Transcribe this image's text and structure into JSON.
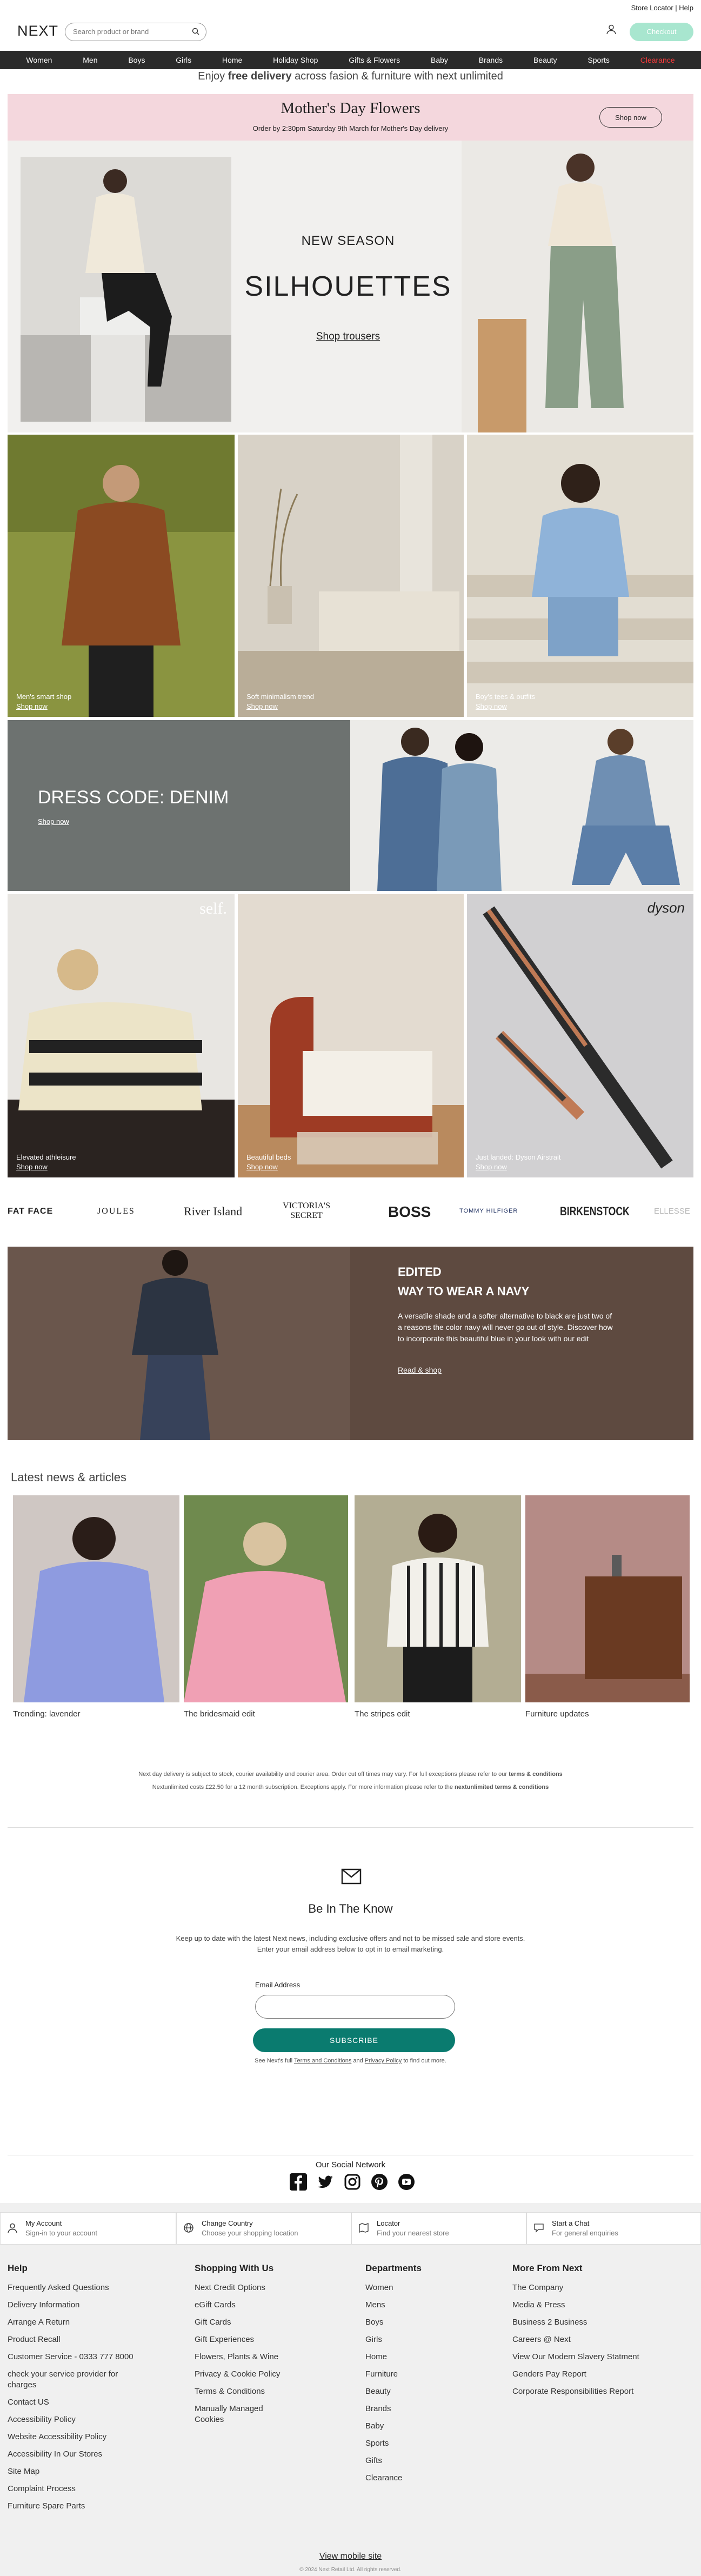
{
  "utility": {
    "links": "Store Locator | Help"
  },
  "header": {
    "logo": "NEXT",
    "search_placeholder": "Search product or brand",
    "checkout": "Checkout"
  },
  "nav": [
    "Women",
    "Men",
    "Boys",
    "Girls",
    "Home",
    "Holiday Shop",
    "Gifts & Flowers",
    "Baby",
    "Brands",
    "Beauty",
    "Sports",
    "Clearance"
  ],
  "promo": {
    "prefix": "Enjoy ",
    "bold": "free delivery",
    "suffix": " across fasion & furniture with next unlimited"
  },
  "mothers_day": {
    "title": "Mother's Day Flowers",
    "subtitle": "Order by 2:30pm Saturday 9th March for Mother's Day delivery",
    "button": "Shop now"
  },
  "hero": {
    "eyebrow": "NEW SEASON",
    "title": "SILHOUETTES",
    "link": "Shop trousers"
  },
  "tiles_row1": [
    {
      "caption": "Men's smart shop",
      "link": "Shop now"
    },
    {
      "caption": "Soft minimalism trend",
      "link": "Shop now"
    },
    {
      "caption": "Boy's tees & outfits",
      "link": "Shop now"
    }
  ],
  "denim": {
    "title": "DRESS CODE: DENIM",
    "link": "Shop now"
  },
  "tiles_row2": [
    {
      "caption": "Elevated athleisure",
      "link": "Shop now",
      "badge": "self."
    },
    {
      "caption": "Beautiful beds",
      "link": "Shop now"
    },
    {
      "caption": "Just landed: Dyson Airstrait",
      "link": "Shop now",
      "badge": "dyson"
    }
  ],
  "brands": [
    "FAT FACE",
    "JOULES",
    "River Island",
    "VICTORIA'S SECRET",
    "BOSS",
    "TOMMY HILFIGER",
    "BIRKENSTOCK",
    "ELLESSE"
  ],
  "edited": {
    "eyebrow": "EDITED",
    "title": "WAY TO WEAR A NAVY",
    "body": "A versatile shade and a softer alternative to black are just two of a reasons the color navy will never go out of style. Discover how to incorporate this beautiful blue in your look with our edit",
    "link": "Read & shop"
  },
  "news": {
    "title": "Latest news & articles",
    "items": [
      {
        "label": "Trending: lavender"
      },
      {
        "label": "The bridesmaid edit"
      },
      {
        "label": "The stripes edit"
      },
      {
        "label": "Furniture updates"
      }
    ]
  },
  "legal": {
    "line1": "Next day delivery is subject to stock, courier availability and courier area. Order cut off times may vary. For full exceptions please refer to our",
    "line1_link": "terms & conditions",
    "line2": "Nextunlimited costs £22.50 for a 12 month subscription. Exceptions apply. For more information please refer to the",
    "line2_link": "nextunlimited terms & conditions"
  },
  "newsletter": {
    "title": "Be In The Know",
    "body1": "Keep up to date with the latest Next news, including exclusive offers and not to be missed sale and store events.",
    "body2": "Enter your email address below to opt in to email marketing.",
    "field_label": "Email Address",
    "button": "SUBSCRIBE",
    "fine_prefix": "See Next's full",
    "terms": "Terms and Conditions",
    "and": "and",
    "privacy": "Privacy Policy",
    "fine_suffix": "to find out more."
  },
  "social": {
    "title": "Our Social Network"
  },
  "help_boxes": [
    {
      "title": "My Account",
      "sub": "Sign-in to your account"
    },
    {
      "title": "Change Country",
      "sub": "Choose your shopping location"
    },
    {
      "title": "Locator",
      "sub": "Find your nearest store"
    },
    {
      "title": "Start a Chat",
      "sub": "For general enquiries"
    }
  ],
  "footer": {
    "help": {
      "title": "Help",
      "items": [
        "Frequently Asked Questions",
        "Delivery Information",
        "Arrange A Return",
        "Product Recall",
        "Customer Service - 0333 777 8000",
        "check your service provider for charges",
        "Contact US",
        "Accessibility Policy",
        "Website Accessibility Policy",
        "Accessibility In Our Stores",
        "Site Map",
        "Complaint Process",
        "Furniture Spare Parts"
      ]
    },
    "shopping": {
      "title": "Shopping With Us",
      "items": [
        "Next Credit Options",
        "eGift Cards",
        "Gift Cards",
        "Gift Experiences",
        "Flowers, Plants & Wine",
        "Privacy & Cookie Policy",
        "Terms & Conditions",
        "Manually Managed Cookies"
      ]
    },
    "departments": {
      "title": "Departments",
      "items": [
        "Women",
        "Mens",
        "Boys",
        "Girls",
        "Home",
        "Furniture",
        "Beauty",
        "Brands",
        "Baby",
        "Sports",
        "Gifts",
        "Clearance"
      ]
    },
    "more": {
      "title": "More From Next",
      "items": [
        "The Company",
        "Media & Press",
        "Business 2 Business",
        "Careers @ Next",
        "View Our Modern Slavery Statment",
        "Genders Pay Report",
        "Corporate Responsibilities Report"
      ]
    },
    "mobile": "View mobile site",
    "copyright": "© 2024 Next Retail Ltd. All rights reserved."
  }
}
